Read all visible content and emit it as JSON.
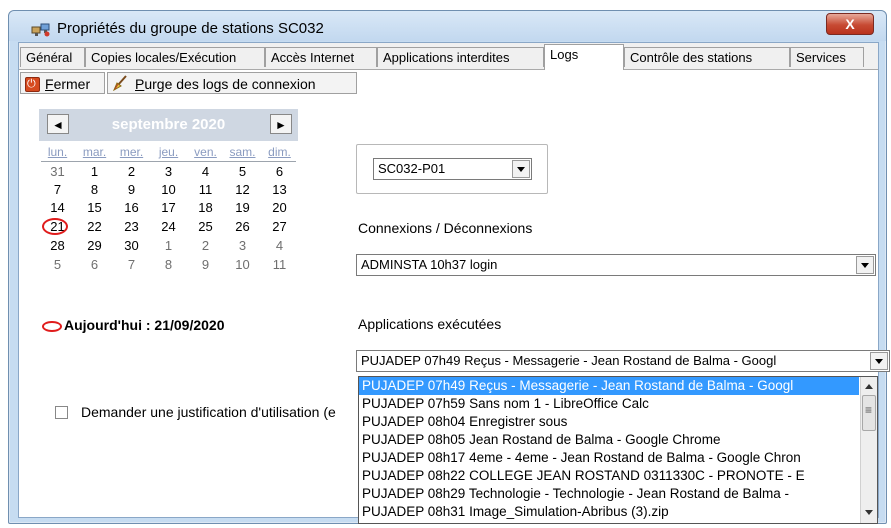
{
  "window": {
    "title": "Propriétés du groupe de stations SC032",
    "close_label": "X"
  },
  "tabs": [
    {
      "label": "Général"
    },
    {
      "label": "Copies locales/Exécution"
    },
    {
      "label": "Accès Internet"
    },
    {
      "label": "Applications interdites"
    },
    {
      "label": "Logs",
      "active": true
    },
    {
      "label": "Contrôle des stations"
    },
    {
      "label": "Services"
    }
  ],
  "toolbar": {
    "close_button": {
      "accel": "F",
      "rest": "ermer"
    },
    "purge_button": {
      "accel": "P",
      "rest": "urge des logs de connexion"
    }
  },
  "calendar": {
    "month_label": "septembre 2020",
    "prev_label": "◄",
    "next_label": "►",
    "weekdays": [
      "lun.",
      "mar.",
      "mer.",
      "jeu.",
      "ven.",
      "sam.",
      "dim."
    ],
    "weeks": [
      [
        {
          "d": "31",
          "o": true
        },
        {
          "d": "1"
        },
        {
          "d": "2"
        },
        {
          "d": "3"
        },
        {
          "d": "4"
        },
        {
          "d": "5"
        },
        {
          "d": "6"
        }
      ],
      [
        {
          "d": "7"
        },
        {
          "d": "8"
        },
        {
          "d": "9"
        },
        {
          "d": "10"
        },
        {
          "d": "11"
        },
        {
          "d": "12"
        },
        {
          "d": "13"
        }
      ],
      [
        {
          "d": "14"
        },
        {
          "d": "15"
        },
        {
          "d": "16"
        },
        {
          "d": "17"
        },
        {
          "d": "18"
        },
        {
          "d": "19"
        },
        {
          "d": "20"
        }
      ],
      [
        {
          "d": "21",
          "today": true
        },
        {
          "d": "22"
        },
        {
          "d": "23"
        },
        {
          "d": "24"
        },
        {
          "d": "25"
        },
        {
          "d": "26"
        },
        {
          "d": "27"
        }
      ],
      [
        {
          "d": "28"
        },
        {
          "d": "29"
        },
        {
          "d": "30"
        },
        {
          "d": "1",
          "o": true
        },
        {
          "d": "2",
          "o": true
        },
        {
          "d": "3",
          "o": true
        },
        {
          "d": "4",
          "o": true
        }
      ],
      [
        {
          "d": "5",
          "o": true
        },
        {
          "d": "6",
          "o": true
        },
        {
          "d": "7",
          "o": true
        },
        {
          "d": "8",
          "o": true
        },
        {
          "d": "9",
          "o": true
        },
        {
          "d": "10",
          "o": true
        },
        {
          "d": "11",
          "o": true
        }
      ]
    ],
    "today_label": "Aujourd'hui : 21/09/2020"
  },
  "checkbox": {
    "label": "Demander une justification d'utilisation (e",
    "checked": false
  },
  "station_select": {
    "value": "SC032-P01"
  },
  "connexions": {
    "label": "Connexions / Déconnexions",
    "value": "ADMINSTA 10h37 login"
  },
  "applications": {
    "label": "Applications exécutées",
    "value": "PUJADEP 07h49 Reçus - Messagerie - Jean Rostand de Balma - Googl",
    "options": [
      "PUJADEP 07h49 Reçus - Messagerie - Jean Rostand de Balma - Googl",
      "PUJADEP 07h59 Sans nom 1 - LibreOffice Calc",
      "PUJADEP 08h04 Enregistrer sous",
      "PUJADEP 08h05 Jean Rostand de Balma - Google Chrome",
      "PUJADEP 08h17 4eme - 4eme - Jean Rostand de Balma - Google Chron",
      "PUJADEP 08h22 COLLEGE JEAN ROSTAND 0311330C - PRONOTE - E",
      "PUJADEP 08h29 Technologie - Technologie - Jean Rostand de Balma -",
      "PUJADEP 08h31 Image_Simulation-Abribus (3).zip"
    ],
    "selected_index": 0
  },
  "colors": {
    "selection": "#3399ff",
    "calendar_header": "#cfd7e2",
    "weekday_text": "#8a9bc0",
    "today_marker": "#e01c1c"
  }
}
